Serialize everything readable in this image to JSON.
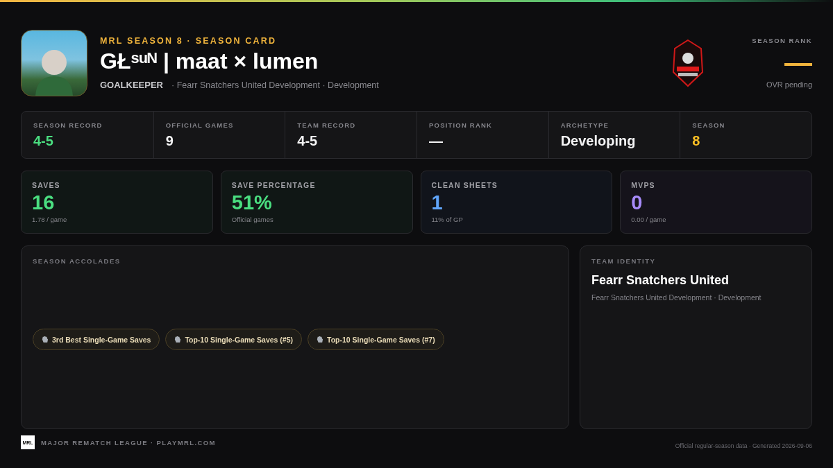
{
  "header": {
    "eyebrow": "MRL SEASON 8 · SEASON CARD",
    "player_name": "GŁˢᵘᴺ | maat × lumen",
    "position": "GOALKEEPER",
    "team_line": "· Fearr Snatchers United Development · Development"
  },
  "season_rank": {
    "label": "SEASON RANK",
    "value": "—",
    "note": "OVR pending"
  },
  "summary": [
    {
      "label": "SEASON RECORD",
      "value": "4-5",
      "color": "#4ade80"
    },
    {
      "label": "OFFICIAL GAMES",
      "value": "9",
      "color": "#f4f4f5"
    },
    {
      "label": "TEAM RECORD",
      "value": "4-5",
      "color": "#f4f4f5"
    },
    {
      "label": "POSITION RANK",
      "value": "—",
      "color": "#f4f4f5"
    },
    {
      "label": "ARCHETYPE",
      "value": "Developing",
      "color": "#f4f4f5"
    },
    {
      "label": "SEASON",
      "value": "8",
      "color": "#fbbf24"
    }
  ],
  "stat_cards": [
    {
      "label": "SAVES",
      "value": "16",
      "sub": "1.78 / game",
      "color": "#4ade80"
    },
    {
      "label": "SAVE PERCENTAGE",
      "value": "51%",
      "sub": "Official games",
      "color": "#4ade80"
    },
    {
      "label": "CLEAN SHEETS",
      "value": "1",
      "sub": "11% of GP",
      "color": "#60a5fa"
    },
    {
      "label": "MVPS",
      "value": "0",
      "sub": "0.00 / game",
      "color": "#a78bfa"
    }
  ],
  "accolades": {
    "title": "SEASON ACCOLADES",
    "items": [
      "3rd Best Single-Game Saves",
      "Top-10 Single-Game Saves (#5)",
      "Top-10 Single-Game Saves (#7)"
    ]
  },
  "team_identity": {
    "title": "TEAM IDENTITY",
    "name": "Fearr Snatchers United",
    "sub": "Fearr Snatchers United Development · Development"
  },
  "footer": {
    "logo": "MRL",
    "left": "MAJOR REMATCH LEAGUE · PLAYMRL.COM",
    "right": "Official regular-season data · Generated 2026-09-06"
  }
}
